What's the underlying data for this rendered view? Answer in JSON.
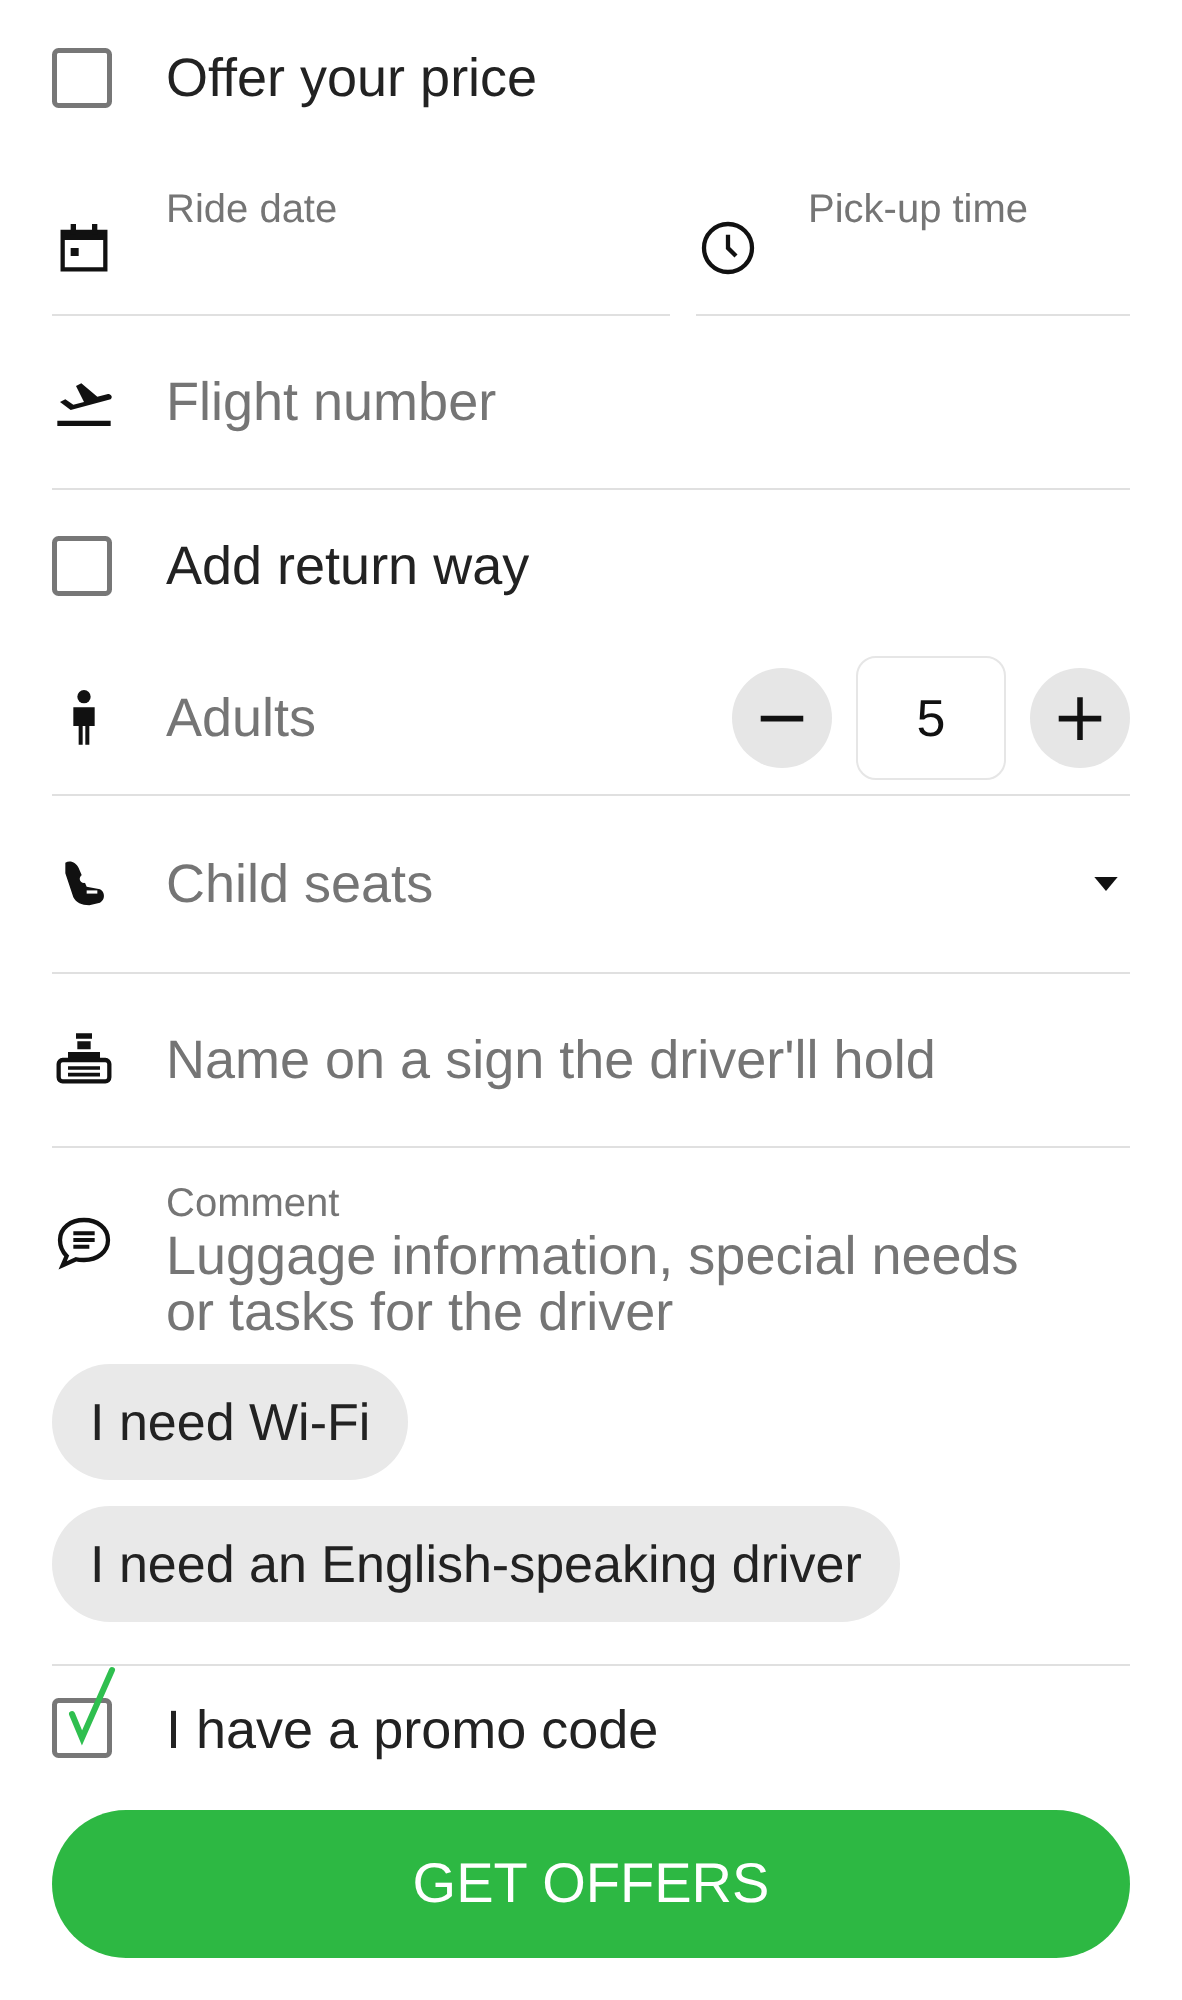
{
  "rows": [
    {
      "kind": "checkbox",
      "label": "Offer your price",
      "checked": false
    },
    {
      "kind": "datetime",
      "fields": [
        {
          "label": "Ride date"
        },
        {
          "label": "Pick-up time"
        }
      ]
    },
    {
      "kind": "field",
      "placeholder": "Flight number"
    },
    {
      "kind": "checkbox",
      "label": "Add return way",
      "checked": false
    },
    {
      "kind": "counter",
      "label": "Adults",
      "minus": "−",
      "value": "5",
      "plus": "+"
    },
    {
      "kind": "select",
      "placeholder": "Child seats"
    },
    {
      "kind": "field",
      "placeholder": "Name on a sign the driver'll hold"
    },
    {
      "kind": "comment",
      "label": "Comment",
      "placeholder": "Luggage information, special needs or tasks for the driver"
    }
  ],
  "chips": [
    {
      "label": "I need Wi-Fi",
      "selected": false
    },
    {
      "label": "I need an English-speaking driver",
      "selected": false
    }
  ],
  "promo": {
    "label": "I have a promo code",
    "checked": true
  },
  "submit": {
    "label": "GET OFFERS"
  }
}
